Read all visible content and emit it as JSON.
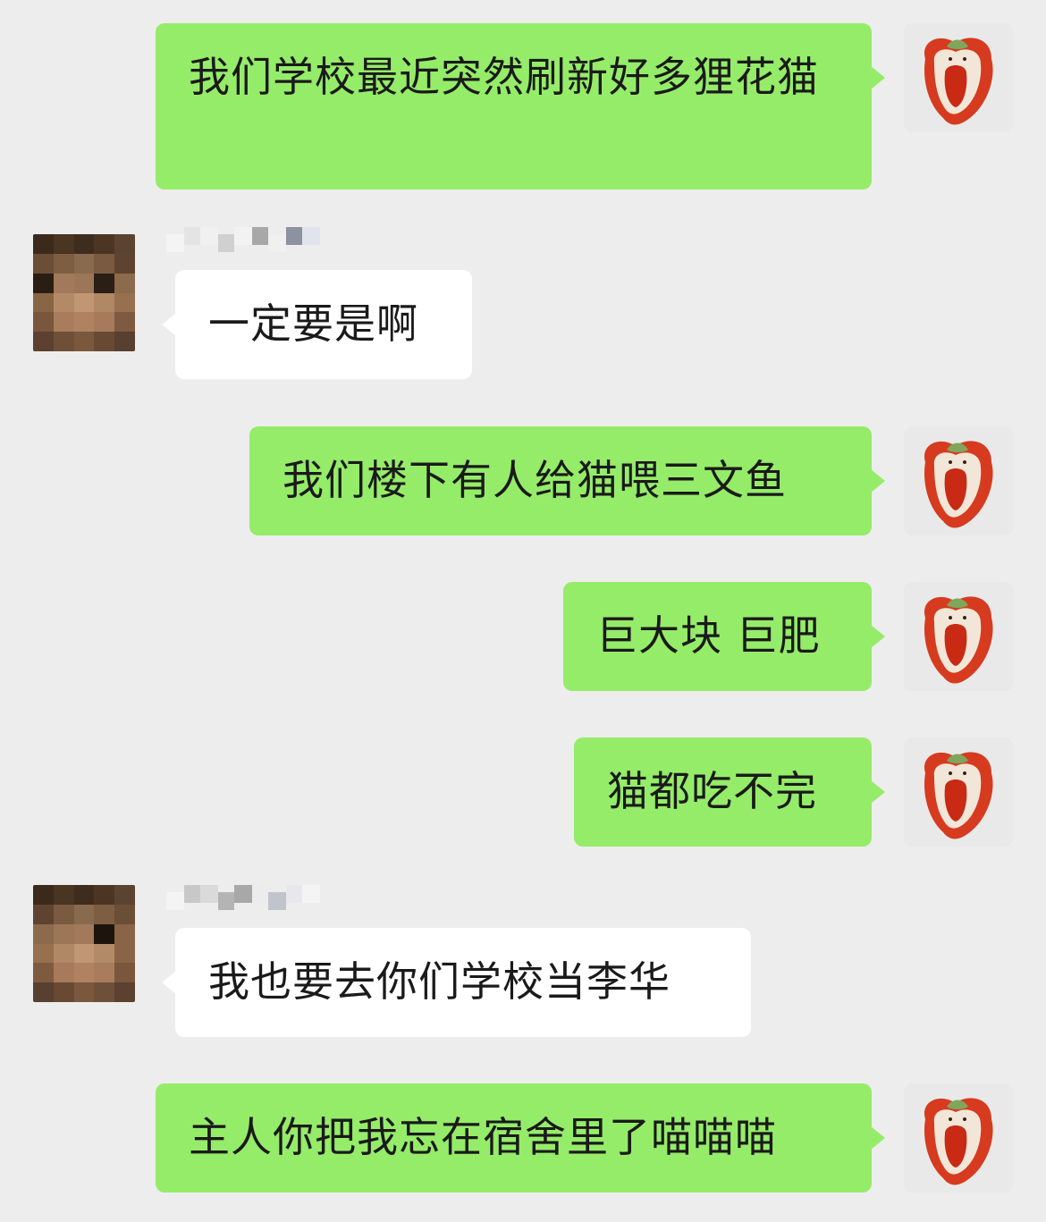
{
  "colors": {
    "background": "#ededed",
    "outgoing_bubble": "#95ec69",
    "incoming_bubble": "#ffffff"
  },
  "self_avatar": {
    "icon": "red-bell-pepper-face-icon"
  },
  "contact_avatar": {
    "icon": "pixelated-face-avatar"
  },
  "messages": [
    {
      "side": "out",
      "text": "我们学校最近突然刷新好多狸花猫"
    },
    {
      "side": "in",
      "text": "一定要是啊"
    },
    {
      "side": "out",
      "text": "我们楼下有人给猫喂三文鱼"
    },
    {
      "side": "out",
      "text": "巨大块 巨肥"
    },
    {
      "side": "out",
      "text": "猫都吃不完"
    },
    {
      "side": "in",
      "text": "我也要去你们学校当李华"
    },
    {
      "side": "out",
      "text": "主人你把我忘在宿舍里了喵喵喵"
    }
  ]
}
